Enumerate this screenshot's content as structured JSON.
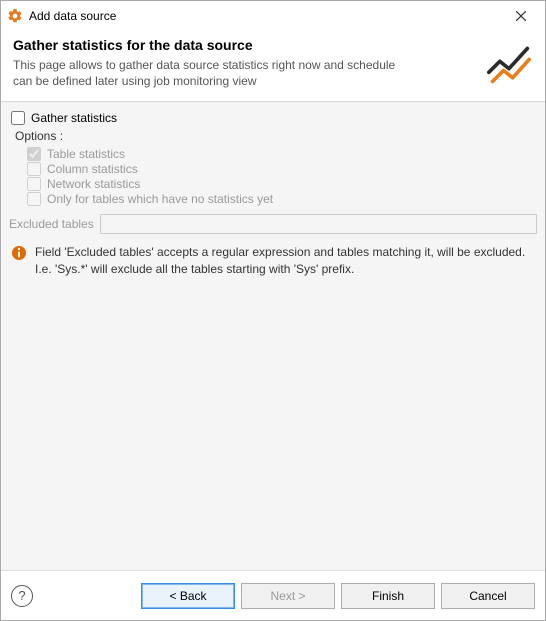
{
  "window": {
    "title": "Add data source"
  },
  "header": {
    "heading": "Gather statistics for the data source",
    "description": "This page allows to gather data source statistics right now and schedule can be defined later using job monitoring view"
  },
  "content": {
    "gather_label": "Gather statistics",
    "options_label": "Options :",
    "options": {
      "table": "Table statistics",
      "column": "Column statistics",
      "network": "Network statistics",
      "only_no_stats": "Only for tables which have no statistics yet"
    },
    "excluded_label": "Excluded tables",
    "excluded_value": "",
    "info_text": "Field 'Excluded tables' accepts a regular expression and tables matching it, will be excluded. I.e. 'Sys.*' will exclude all the tables starting with 'Sys' prefix."
  },
  "buttons": {
    "back": "< Back",
    "next": "Next >",
    "finish": "Finish",
    "cancel": "Cancel"
  }
}
